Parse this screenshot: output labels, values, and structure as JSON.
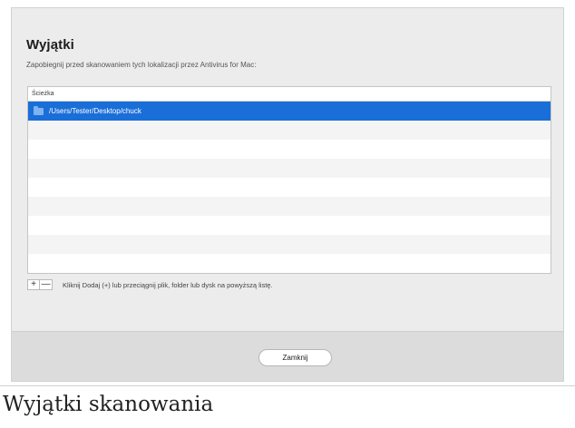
{
  "dialog": {
    "title": "Wyjątki",
    "subtitle": "Zapobiegnij przed skanowaniem tych lokalizacji przez Antivirus for Mac:",
    "table": {
      "column_header": "Ścieżka",
      "rows": [
        {
          "path": "/Users/Tester/Desktop/chuck",
          "icon": "folder-icon",
          "selected": true
        }
      ]
    },
    "add_label": "+",
    "remove_label": "—",
    "hint": "Kliknij Dodaj (+) lub przeciągnij plik, folder lub dysk na powyższą listę.",
    "close_label": "Zamknij"
  },
  "caption": "Wyjątki skanowania",
  "colors": {
    "selection": "#1a6ed8",
    "folder": "#7fb2f0",
    "dialog_bg": "#ececec",
    "footer_bg": "#dcdcdc"
  }
}
